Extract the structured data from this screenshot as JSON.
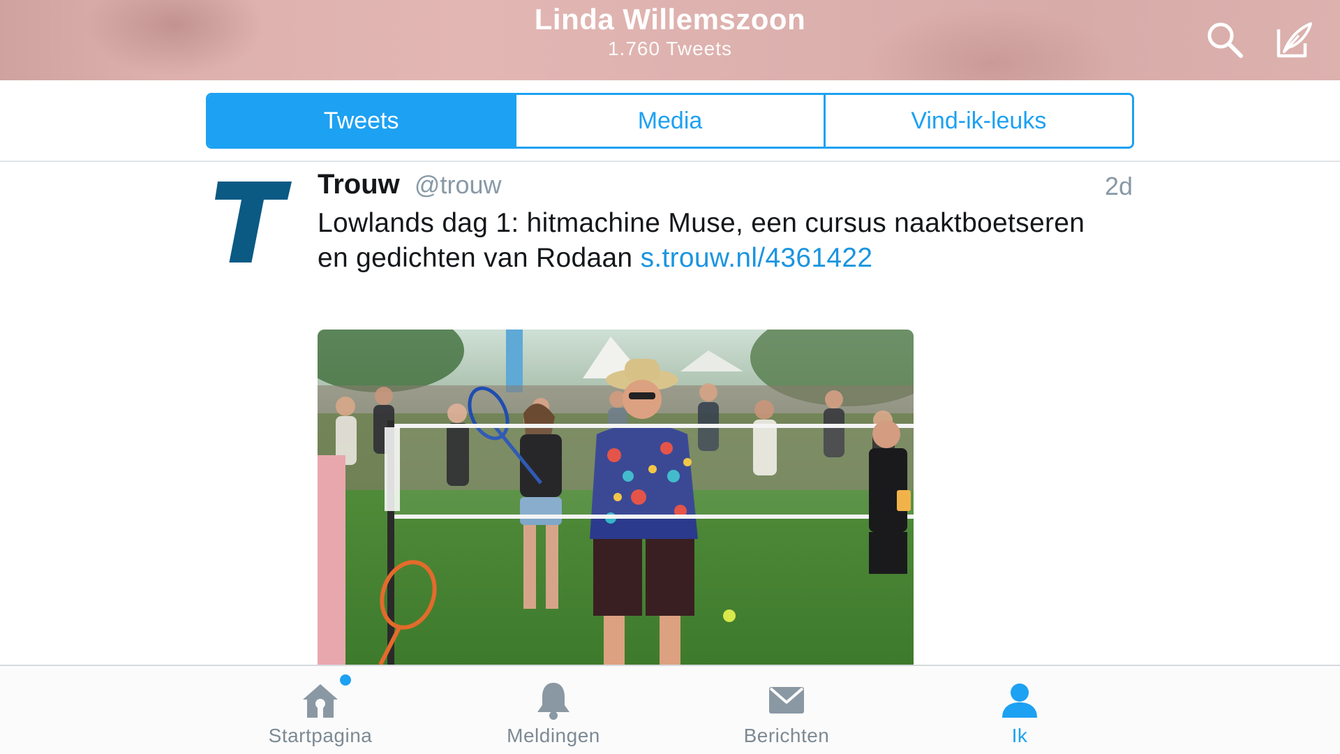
{
  "colors": {
    "accent": "#1da1f2",
    "header_bg": "#dcb0ad",
    "link": "#1b95e0",
    "muted": "#8899a6",
    "trouw_brand": "#0b5a84"
  },
  "header": {
    "title": "Linda Willemszoon",
    "subtitle": "1.760 Tweets",
    "search_icon": "search-icon",
    "compose_icon": "compose-icon"
  },
  "segments": {
    "active_index": 0,
    "items": [
      {
        "label": "Tweets"
      },
      {
        "label": "Media"
      },
      {
        "label": "Vind-ik-leuks"
      }
    ]
  },
  "tweet": {
    "author_name": "Trouw",
    "author_handle": "@trouw",
    "time": "2d",
    "avatar_letter": "T",
    "text": "Lowlands dag 1: hitmachine Muse, een cursus naaktboetseren en gedichten van Rodaan ",
    "link": "s.trouw.nl/​4361422",
    "media": {
      "icon": "photo"
    }
  },
  "tabbar": {
    "active_index": 3,
    "items": [
      {
        "label": "Startpagina",
        "icon": "home-icon",
        "has_badge": true
      },
      {
        "label": "Meldingen",
        "icon": "bell-icon",
        "has_badge": false
      },
      {
        "label": "Berichten",
        "icon": "envelope-icon",
        "has_badge": false
      },
      {
        "label": "Ik",
        "icon": "person-icon",
        "has_badge": false
      }
    ]
  }
}
